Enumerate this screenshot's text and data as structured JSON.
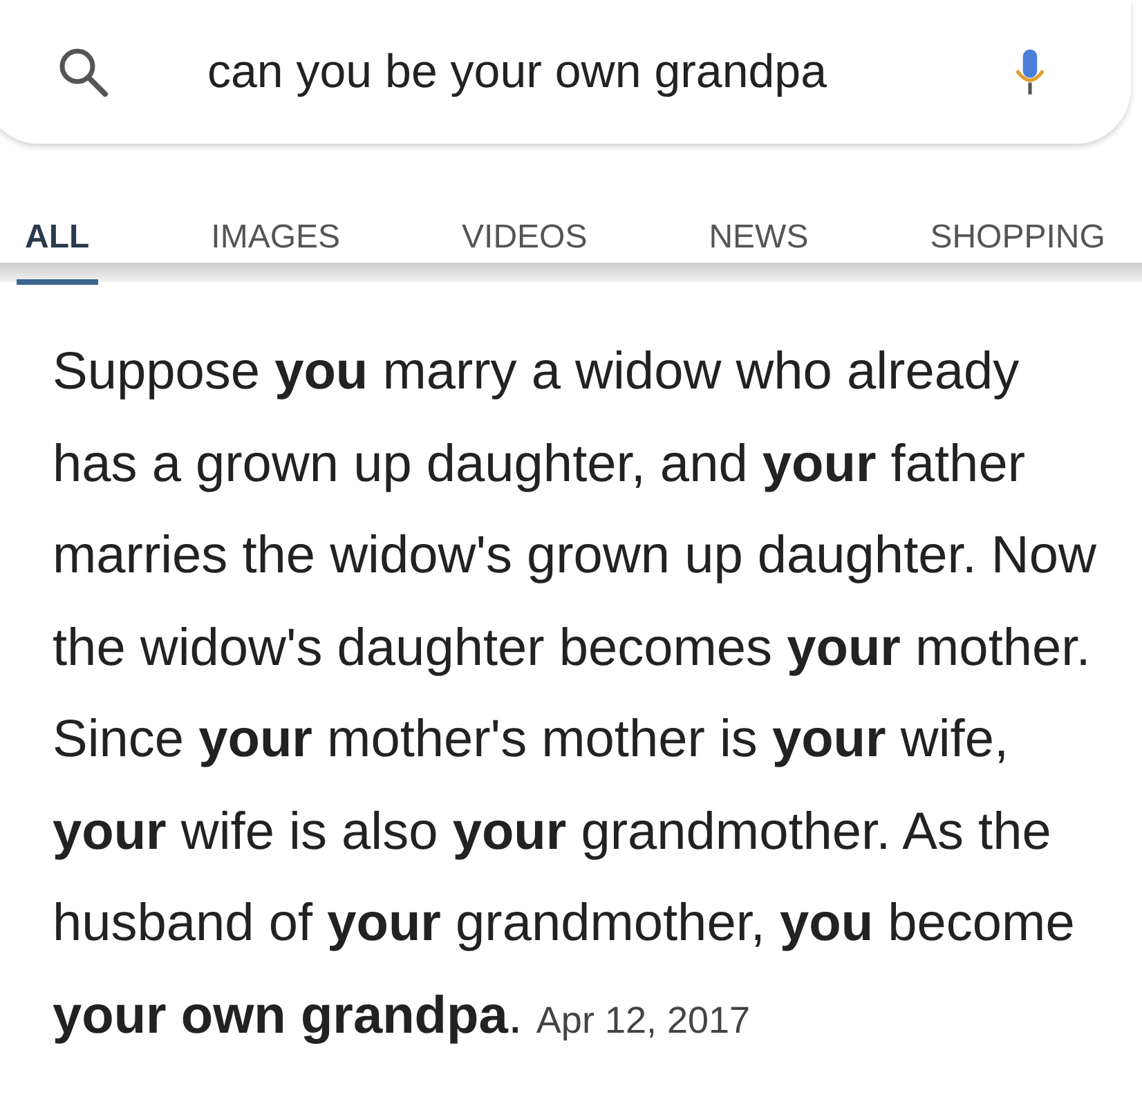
{
  "search": {
    "value": "can you be your own grandpa"
  },
  "tabs": [
    {
      "label": "ALL",
      "selected": true
    },
    {
      "label": "IMAGES",
      "selected": false
    },
    {
      "label": "VIDEOS",
      "selected": false
    },
    {
      "label": "NEWS",
      "selected": false
    },
    {
      "label": "SHOPPING",
      "selected": false
    }
  ],
  "answer": {
    "text": "Suppose **you** marry a widow who already has a grown up daughter, and **your** father marries the widow's grown up daughter. Now the widow's daughter becomes **your** mother. Since **your** mother's mother is **your** wife, **your** wife is also **your** grandmother. As the husband of **your** grandmother, **you** become **your own grandpa**.",
    "date": "Apr 12, 2017"
  }
}
